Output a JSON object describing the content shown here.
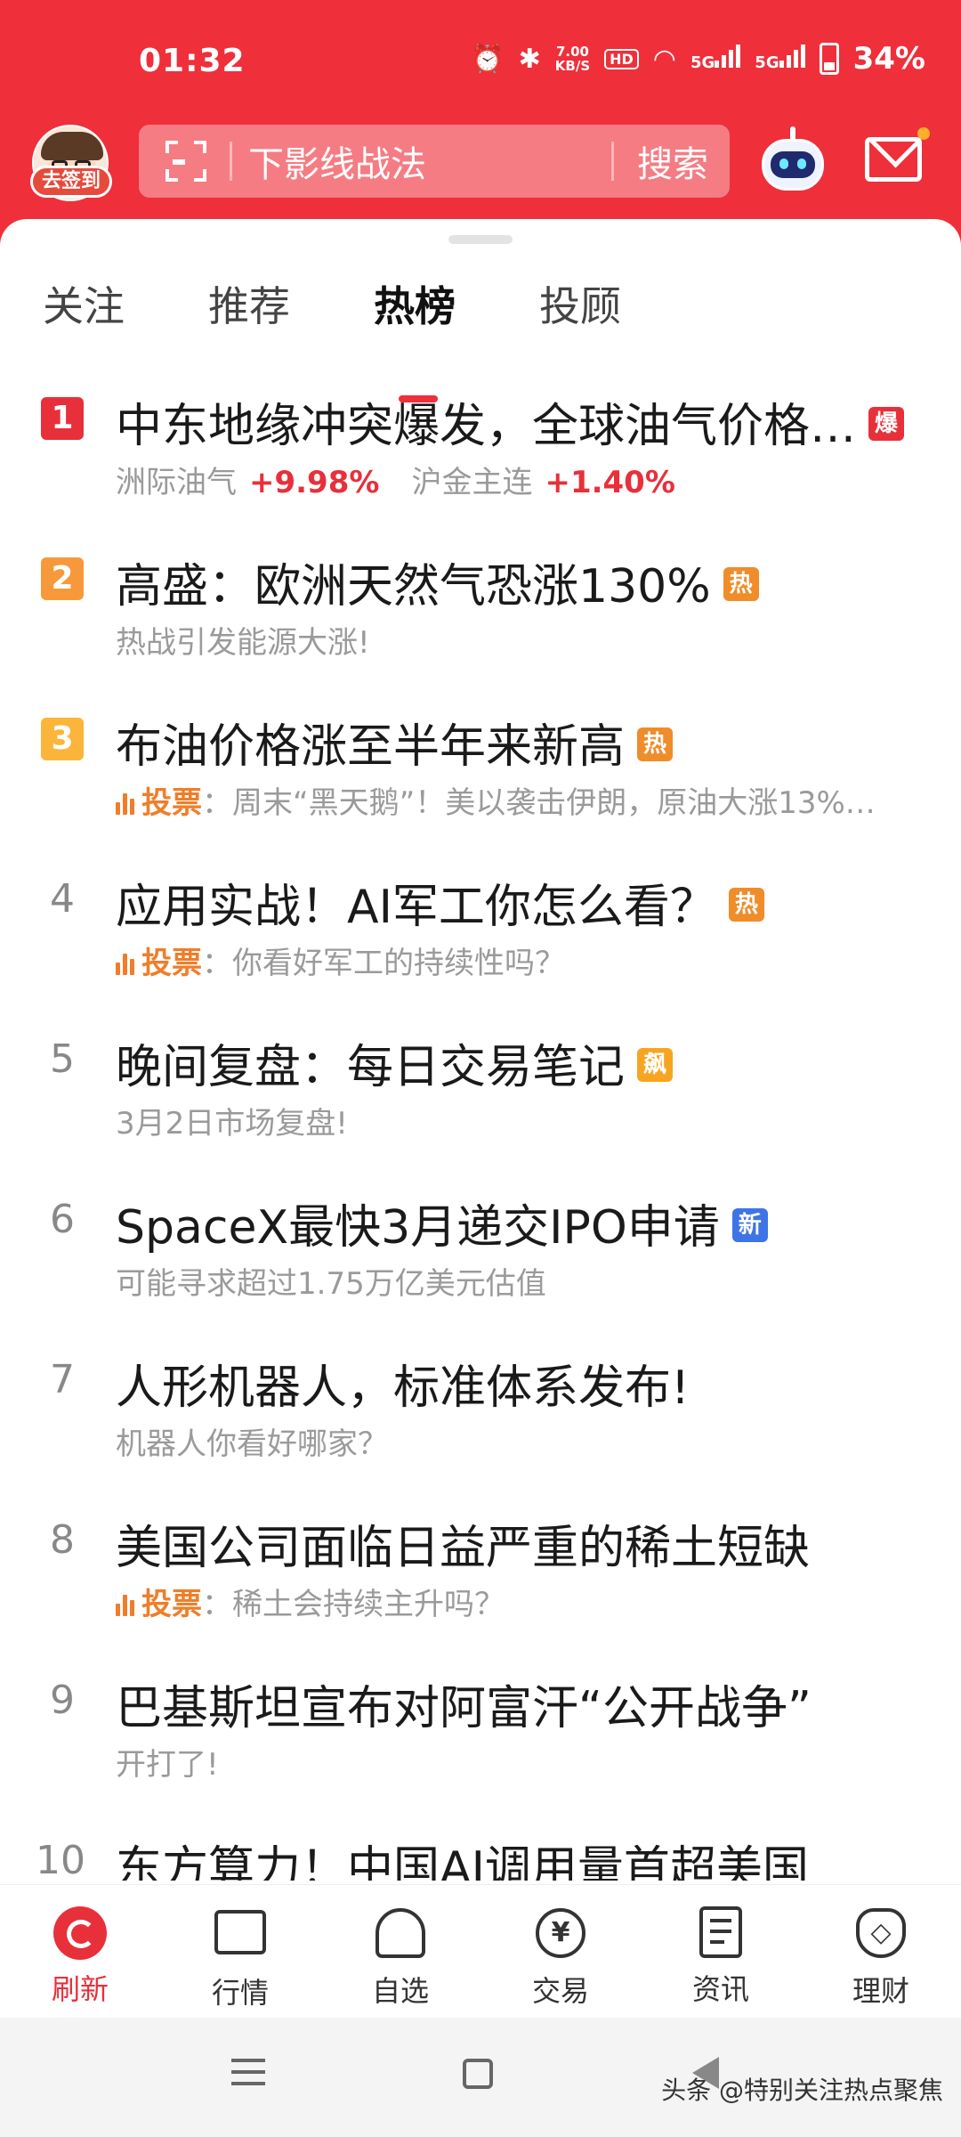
{
  "status_bar": {
    "time": "01:32",
    "net_speed_value": "7.00",
    "net_speed_unit": "KB/S",
    "hd_label": "HD",
    "sig1_label": "5G",
    "sig2_label": "5G",
    "battery": "34%"
  },
  "header": {
    "signin_label": "去签到",
    "search_placeholder": "下影线战法",
    "search_button": "搜索"
  },
  "tabs": [
    {
      "label": "关注",
      "active": false
    },
    {
      "label": "推荐",
      "active": false
    },
    {
      "label": "热榜",
      "active": true
    },
    {
      "label": "投顾",
      "active": false
    }
  ],
  "hot_list": [
    {
      "rank": "1",
      "title": "中东地缘冲突爆发，全球油气价格…",
      "tag": "爆",
      "tag_color": "#e8303a",
      "sub": {
        "item1": "洲际油气",
        "item1_change": "+9.98%",
        "item2": "沪金主连",
        "item2_change": "+1.40%"
      }
    },
    {
      "rank": "2",
      "title": "高盛：欧洲天然气恐涨130%",
      "tag": "热",
      "sub_text": "热战引发能源大涨!"
    },
    {
      "rank": "3",
      "title": "布油价格涨至半年来新高",
      "tag": "热",
      "vote_label": "投票",
      "sub_text": "：周末“黑天鹅”！美以袭击伊朗，原油大涨13%…"
    },
    {
      "rank": "4",
      "title": "应用实战！AI军工你怎么看？",
      "tag": "热",
      "vote_label": "投票",
      "sub_text": "：你看好军工的持续性吗？"
    },
    {
      "rank": "5",
      "title": "晚间复盘：每日交易笔记",
      "tag": "飙",
      "sub_text": "3月2日市场复盘!"
    },
    {
      "rank": "6",
      "title": "SpaceX最快3月递交IPO申请",
      "tag": "新",
      "sub_text": "可能寻求超过1.75万亿美元估值"
    },
    {
      "rank": "7",
      "title": "人形机器人，标准体系发布!",
      "sub_text": "机器人你看好哪家？"
    },
    {
      "rank": "8",
      "title": "美国公司面临日益严重的稀土短缺",
      "vote_label": "投票",
      "sub_text": "：稀土会持续主升吗？"
    },
    {
      "rank": "9",
      "title": "巴基斯坦宣布对阿富汗“公开战争”",
      "sub_text": "开打了!"
    },
    {
      "rank": "10",
      "title": "东方算力！中国AI调用量首超美国"
    }
  ],
  "bottom_nav": [
    {
      "label": "刷新",
      "icon": "refresh-icon",
      "active": true
    },
    {
      "label": "行情",
      "icon": "chart-icon"
    },
    {
      "label": "自选",
      "icon": "user-icon"
    },
    {
      "label": "交易",
      "icon": "yuan-icon"
    },
    {
      "label": "资讯",
      "icon": "news-icon"
    },
    {
      "label": "理财",
      "icon": "money-bag-icon"
    }
  ],
  "yuan_glyph": "¥",
  "watermark": "头条 @特别关注热点聚焦"
}
